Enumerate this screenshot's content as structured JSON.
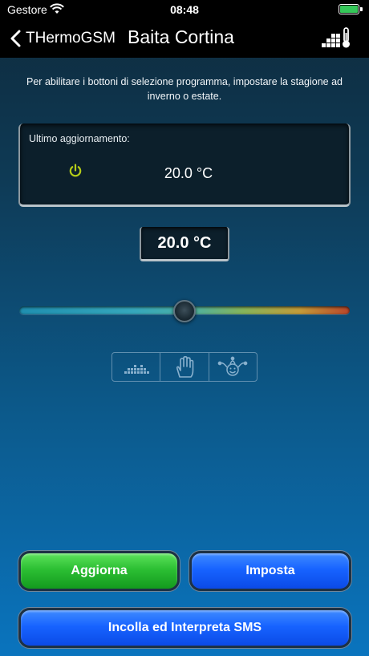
{
  "status_bar": {
    "carrier": "Gestore",
    "time": "08:48",
    "battery_level": 1.0,
    "battery_color": "#35c759"
  },
  "nav": {
    "back_label": "THermoGSM",
    "title": "Baita Cortina",
    "right_icon": "program-thermometer-icon"
  },
  "info_text": "Per abilitare i bottoni di selezione programma, impostare la stagione ad inverno o estate.",
  "status_panel": {
    "label": "Ultimo aggiornamento:",
    "power_icon": "power-icon",
    "power_color": "#b5cc18",
    "temperature": "20.0 °C"
  },
  "setpoint": {
    "temperature": "20.0 °C"
  },
  "slider": {
    "value_fraction": 0.5
  },
  "mode_buttons": [
    {
      "icon": "program-bars-icon"
    },
    {
      "icon": "hand-icon"
    },
    {
      "icon": "jester-icon"
    }
  ],
  "buttons": {
    "refresh": "Aggiorna",
    "set": "Imposta",
    "paste_sms": "Incolla ed Interpreta SMS"
  }
}
